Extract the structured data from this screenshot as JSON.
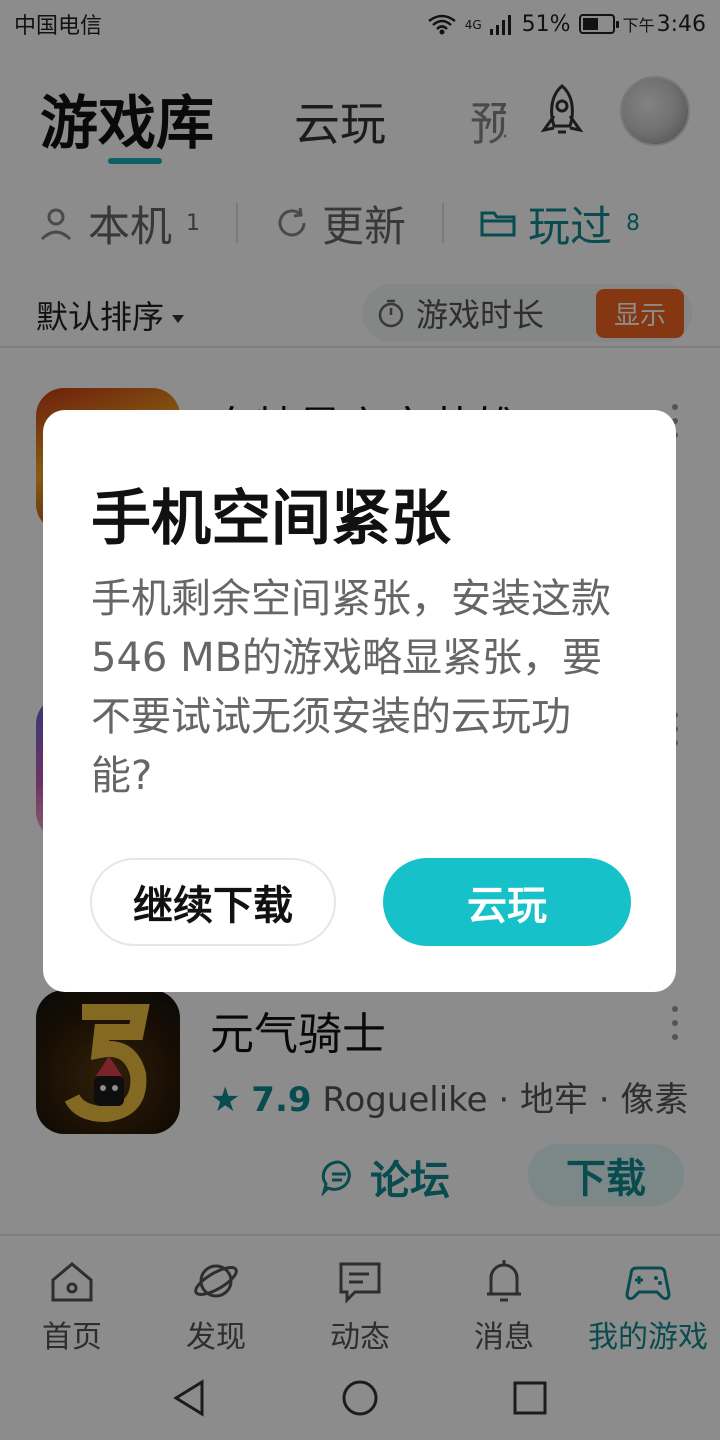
{
  "status_bar": {
    "carrier": "中国电信",
    "network": "4G",
    "battery": "51%",
    "time_prefix": "下午",
    "time": "3:46"
  },
  "top_tabs": {
    "main": "游戏库",
    "cloud": "云玩",
    "pre": "预"
  },
  "filters": [
    {
      "label": "本机",
      "count": "1",
      "icon": "phone-user-icon"
    },
    {
      "label": "更新",
      "count": "",
      "icon": "refresh-icon"
    },
    {
      "label": "玩过",
      "count": "8",
      "icon": "folder-icon"
    }
  ],
  "sort": {
    "label": "默认排序",
    "playtime_label": "游戏时长",
    "show_label": "显示"
  },
  "games": [
    {
      "title": "奥特曼宇宙英雄"
    },
    {
      "title": ""
    },
    {
      "title": "元气骑士",
      "score": "7.9",
      "tags": "Roguelike · 地牢 · 像素",
      "forum_label": "论坛",
      "download_label": "下载"
    }
  ],
  "bottom_nav": [
    {
      "label": "首页",
      "icon": "home-icon"
    },
    {
      "label": "发现",
      "icon": "planet-icon"
    },
    {
      "label": "动态",
      "icon": "message-icon"
    },
    {
      "label": "消息",
      "icon": "bell-icon"
    },
    {
      "label": "我的游戏",
      "icon": "gamepad-icon"
    }
  ],
  "dialog": {
    "title": "手机空间紧张",
    "body": "手机剩余空间紧张，安装这款546 MB的游戏略显紧张，要不要试试无须安装的云玩功能?",
    "continue_label": "继续下载",
    "cloud_label": "云玩"
  },
  "colors": {
    "accent": "#17c1c9",
    "accent_dark": "#128a93",
    "warning": "#f26522"
  }
}
